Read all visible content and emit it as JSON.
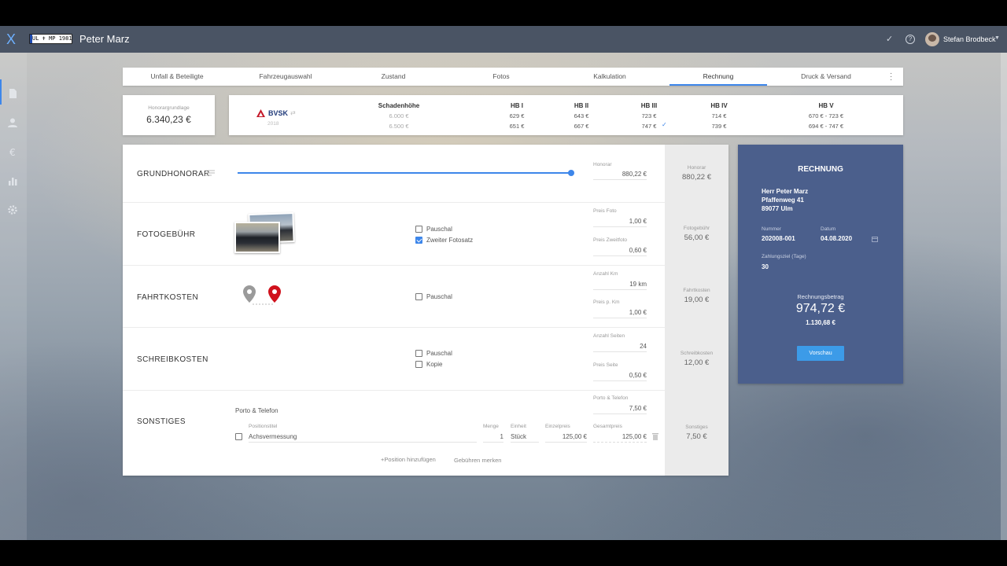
{
  "window": {
    "title": "Peter Marz",
    "plate": "UL ✝ MP 1981",
    "user": "Stefan Brodbeck"
  },
  "tabs": [
    "Unfall & Beteiligte",
    "Fahrzeugauswahl",
    "Zustand",
    "Fotos",
    "Kalkulation",
    "Rechnung",
    "Druck & Versand"
  ],
  "active_tab": "Rechnung",
  "honorargrundlage": {
    "label": "Honorargrundlage",
    "value": "6.340,23 €"
  },
  "bvsk": {
    "logo": "BVSK",
    "year": "2018",
    "headers": [
      "Schadenhöhe",
      "HB I",
      "HB II",
      "HB III",
      "HB IV",
      "HB V"
    ],
    "rows": [
      [
        "6.000 €",
        "629 €",
        "643 €",
        "723 €",
        "714 €",
        "670 € - 723 €"
      ],
      [
        "6.500 €",
        "651 €",
        "667 €",
        "747 €",
        "739 €",
        "694 € - 747 €"
      ]
    ]
  },
  "grundhonorar": {
    "title": "GRUNDHONORAR",
    "field_label": "Honorar",
    "field_value": "880,22 €",
    "sum_label": "Honorar",
    "sum_value": "880,22 €"
  },
  "fotogebuehr": {
    "title": "FOTOGEBÜHR",
    "checkboxes": [
      {
        "label": "Pauschal",
        "checked": false
      },
      {
        "label": "Zweiter Fotosatz",
        "checked": true
      }
    ],
    "fields": [
      {
        "label": "Preis Foto",
        "value": "1,00 €"
      },
      {
        "label": "Preis Zweitfoto",
        "value": "0,60 €"
      }
    ],
    "sum_label": "Fotogebühr",
    "sum_value": "56,00 €"
  },
  "fahrtkosten": {
    "title": "FAHRTKOSTEN",
    "checkboxes": [
      {
        "label": "Pauschal",
        "checked": false
      }
    ],
    "fields": [
      {
        "label": "Anzahl Km",
        "value": "19 km"
      },
      {
        "label": "Preis p. Km",
        "value": "1,00 €"
      }
    ],
    "sum_label": "Fahrtkosten",
    "sum_value": "19,00 €"
  },
  "schreibkosten": {
    "title": "SCHREIBKOSTEN",
    "checkboxes": [
      {
        "label": "Pauschal",
        "checked": false
      },
      {
        "label": "Kopie",
        "checked": false
      }
    ],
    "fields": [
      {
        "label": "Anzahl Seiten",
        "value": "24"
      },
      {
        "label": "Preis Seite",
        "value": "0,50 €"
      }
    ],
    "sum_label": "Schreibkosten",
    "sum_value": "12,00 €"
  },
  "sonstiges": {
    "title": "SONSTIGES",
    "porto_label": "Porto & Telefon",
    "porto_field_label": "Porto & Telefon",
    "porto_value": "7,50 €",
    "position": {
      "labels": {
        "title": "Positionstitel",
        "menge": "Menge",
        "einheit": "Einheit",
        "einzelpreis": "Einzelpreis",
        "gesamtpreis": "Gesamtpreis"
      },
      "title": "Achsvermessung",
      "menge": "1",
      "einheit": "Stück",
      "einzelpreis": "125,00 €",
      "gesamtpreis": "125,00 €"
    },
    "add_position": "Position hinzufügen",
    "remember_fees": "Gebühren merken",
    "sum_label": "Sonstiges",
    "sum_value": "7,50 €"
  },
  "rechnung": {
    "title": "RECHNUNG",
    "address": [
      "Herr Peter Marz",
      "Pfaffenweg 41",
      "89077 Ulm"
    ],
    "nummer_label": "Nummer",
    "nummer": "202008-001",
    "datum_label": "Datum",
    "datum": "04.08.2020",
    "zahlungsziel_label": "Zahlungsziel (Tage)",
    "zahlungsziel": "30",
    "betrag_label": "Rechnungsbetrag",
    "betrag_netto": "974,72 €",
    "betrag_brutto": "1.130,68 €",
    "button": "Vorschau"
  },
  "colors": {
    "accent": "#3d86ea",
    "topbar": "#4a5464",
    "invoice_panel": "#4b5f8c",
    "button": "#3c9be8"
  }
}
